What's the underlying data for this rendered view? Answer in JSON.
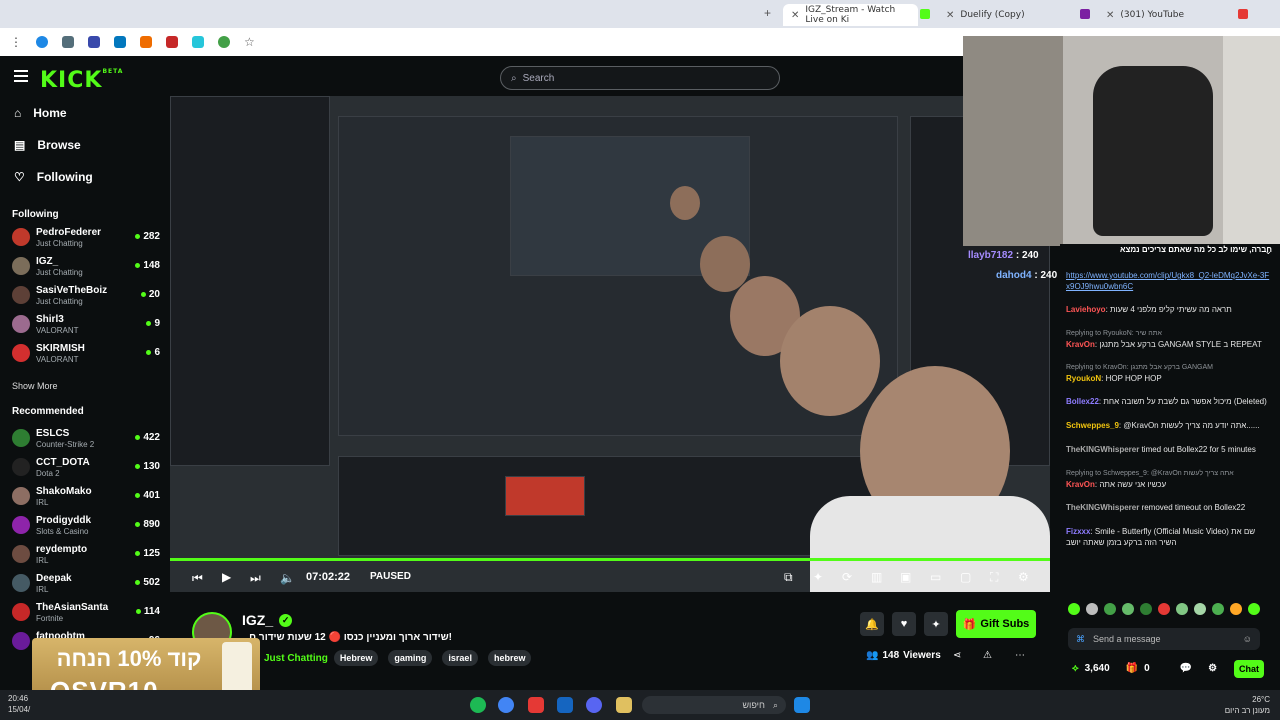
{
  "browser": {
    "tabs": [
      {
        "label": "IGZ_Stream - Watch Live on Ki",
        "active": true
      },
      {
        "label": "Duelify (Copy)",
        "active": false
      },
      {
        "label": "(301) YouTube",
        "active": false
      }
    ]
  },
  "kick": {
    "logo": "KICK",
    "logo_sup": "BETA",
    "nav": [
      {
        "label": "Home",
        "icon": "home-icon"
      },
      {
        "label": "Browse",
        "icon": "browse-icon"
      },
      {
        "label": "Following",
        "icon": "heart-icon"
      }
    ],
    "following_heading": "Following",
    "following": [
      {
        "name": "PedroFederer",
        "game": "Just Chatting",
        "viewers": "282",
        "color": "#c0392b"
      },
      {
        "name": "IGZ_",
        "game": "Just Chatting",
        "viewers": "148",
        "color": "#7b6d5a"
      },
      {
        "name": "SasiVeTheBoiz",
        "game": "Just Chatting",
        "viewers": "20",
        "color": "#5d4037"
      },
      {
        "name": "Shirl3",
        "game": "VALORANT",
        "viewers": "9",
        "color": "#9c6b8f"
      },
      {
        "name": "SKIRMISH",
        "game": "VALORANT",
        "viewers": "6",
        "color": "#d32f2f"
      }
    ],
    "show_more": "Show More",
    "recommended_heading": "Recommended",
    "recommended": [
      {
        "name": "ESLCS",
        "game": "Counter-Strike 2",
        "viewers": "422",
        "color": "#2e7d32"
      },
      {
        "name": "CCT_DOTA",
        "game": "Dota 2",
        "viewers": "130",
        "color": "#222"
      },
      {
        "name": "ShakoMako",
        "game": "IRL",
        "viewers": "401",
        "color": "#8d6e63"
      },
      {
        "name": "Prodigyddk",
        "game": "Slots & Casino",
        "viewers": "890",
        "color": "#8e24aa"
      },
      {
        "name": "reydempto",
        "game": "IRL",
        "viewers": "125",
        "color": "#6d4c41"
      },
      {
        "name": "Deepak",
        "game": "IRL",
        "viewers": "502",
        "color": "#455a64"
      },
      {
        "name": "TheAsianSanta",
        "game": "Fortnite",
        "viewers": "114",
        "color": "#c62828"
      },
      {
        "name": "fatnoobtm",
        "game": "",
        "viewers": "96",
        "color": "#6a1b9a"
      }
    ],
    "search_placeholder": "Search"
  },
  "player": {
    "time": "07:02:22",
    "status": "PAUSED"
  },
  "stream": {
    "streamer": "IGZ_",
    "title": "!שידור ארוך ומעניין כנסו 🔴 12 שעות שידור ח",
    "category": "Just Chatting",
    "tags": [
      "Hebrew",
      "gaming",
      "israel",
      "hebrew"
    ],
    "viewers": "148",
    "viewers_label": "Viewers",
    "gift_button": "Gift Subs"
  },
  "ad": {
    "line1": "קוד 10% הנחה",
    "line2": "OSVR10"
  },
  "chat": {
    "pinned_top": "חברה, שימו לב כל מה שאתם צריכים נמצא",
    "overlay_users": [
      {
        "name": "llayb7182",
        "count": "240"
      },
      {
        "name": "dahod4",
        "count": "240"
      }
    ],
    "link": "https://www.youtube.com/clip/Ugkx8_Q2-leDMq2JvXe-3Fx9OJ9hwu0wbn6C",
    "messages": [
      {
        "reply": "",
        "user": "Laviehoyo",
        "text": ": תראה מה עשיתי קליפ מלפני 4 שעות",
        "color": "#ff5555"
      },
      {
        "reply": "Replying to RyoukoN: אתה שיר",
        "user": "KravOn",
        "text": ": ברקע אבל מתנגן GANGAM STYLE ב REPEAT",
        "color": "#ff5555"
      },
      {
        "reply": "Replying to KravOn: ברקע אבל מתנגן GANGAM",
        "user": "RyoukoN",
        "text": ": HOP HOP HOP",
        "color": "#f1c40f"
      },
      {
        "reply": "",
        "user": "Bollex22",
        "text": ": מיכול אפשר גם לשבת על תשובה אחת (Deleted)",
        "color": "#8e7cff"
      },
      {
        "reply": "",
        "user": "Schweppes_9",
        "text": ": @KravOn אתה יודע מה צריך לעשות......",
        "color": "#f1c40f"
      },
      {
        "reply": "",
        "user": "TheKINGWhisperer",
        "text": " timed out Bollex22 for 5 minutes",
        "color": "#aaa"
      },
      {
        "reply": "Replying to Schweppes_9: @KravOn אתה צריך לעשות",
        "user": "KravOn",
        "text": ": עכשיו אני עשה אתה",
        "color": "#ff5555"
      },
      {
        "reply": "",
        "user": "TheKINGWhisperer",
        "text": " removed timeout on Bollex22",
        "color": "#aaa"
      },
      {
        "reply": "",
        "user": "Fizxxx",
        "text": ": Smile - Butterfly (Official Music Video) שם את השיר הזה ברקע בזמן שאתה יושב",
        "color": "#8e7cff"
      }
    ],
    "input_placeholder": "Send a message",
    "points": "3,640",
    "subs": "0",
    "chat_button": "Chat"
  },
  "taskbar": {
    "search_text": "חיפוש",
    "temp": "26°C",
    "weather": "מעונן רב היום",
    "time": "20:46",
    "date": "15/04/"
  }
}
